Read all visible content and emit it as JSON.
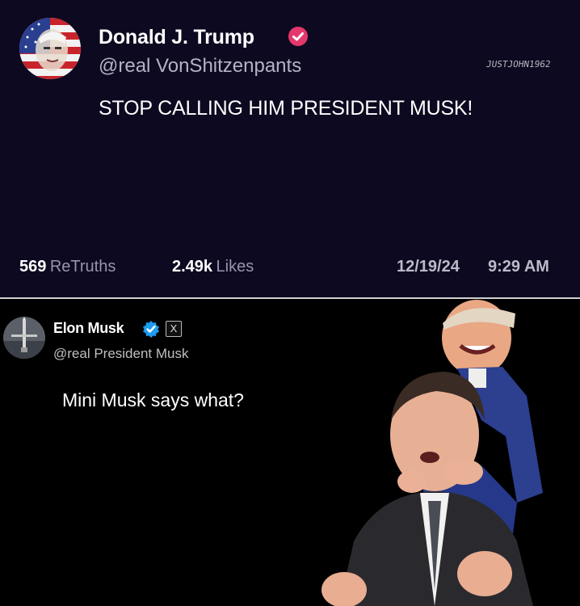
{
  "top_post": {
    "display_name": "Donald J. Trump",
    "handle": "@real VonShitzenpants",
    "watermark": "JUSTJOHN1962",
    "body": "STOP CALLING HIM PRESIDENT MUSK!",
    "retruths_count": "569",
    "retruths_label": "ReTruths",
    "likes_count": "2.49k",
    "likes_label": "Likes",
    "date": "12/19/24",
    "time": "9:29 AM",
    "verify_color": "#e3376d"
  },
  "bottom_post": {
    "display_name": "Elon Musk",
    "badge": "X",
    "handle": "@real President Musk",
    "body": "Mini Musk says what?",
    "verify_color": "#1d9bf0"
  }
}
